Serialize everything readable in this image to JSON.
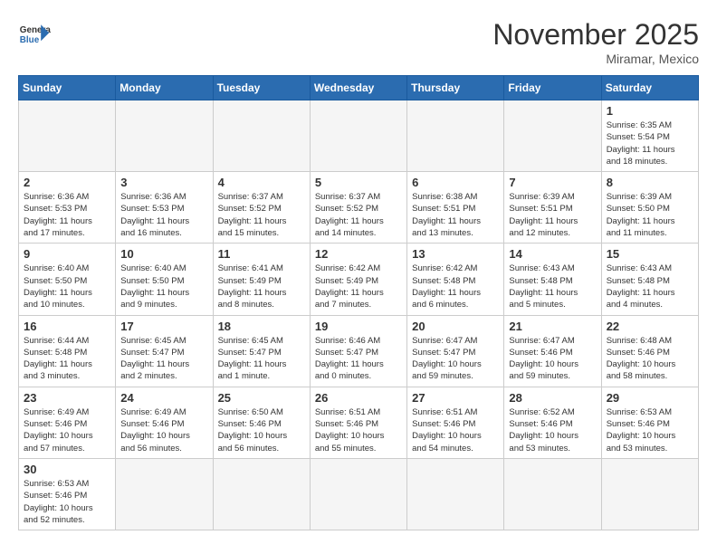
{
  "header": {
    "logo_general": "General",
    "logo_blue": "Blue",
    "month_title": "November 2025",
    "location": "Miramar, Mexico"
  },
  "weekdays": [
    "Sunday",
    "Monday",
    "Tuesday",
    "Wednesday",
    "Thursday",
    "Friday",
    "Saturday"
  ],
  "days": [
    {
      "num": "",
      "info": ""
    },
    {
      "num": "",
      "info": ""
    },
    {
      "num": "",
      "info": ""
    },
    {
      "num": "",
      "info": ""
    },
    {
      "num": "",
      "info": ""
    },
    {
      "num": "",
      "info": ""
    },
    {
      "num": "1",
      "info": "Sunrise: 6:35 AM\nSunset: 5:54 PM\nDaylight: 11 hours\nand 18 minutes."
    },
    {
      "num": "2",
      "info": "Sunrise: 6:36 AM\nSunset: 5:53 PM\nDaylight: 11 hours\nand 17 minutes."
    },
    {
      "num": "3",
      "info": "Sunrise: 6:36 AM\nSunset: 5:53 PM\nDaylight: 11 hours\nand 16 minutes."
    },
    {
      "num": "4",
      "info": "Sunrise: 6:37 AM\nSunset: 5:52 PM\nDaylight: 11 hours\nand 15 minutes."
    },
    {
      "num": "5",
      "info": "Sunrise: 6:37 AM\nSunset: 5:52 PM\nDaylight: 11 hours\nand 14 minutes."
    },
    {
      "num": "6",
      "info": "Sunrise: 6:38 AM\nSunset: 5:51 PM\nDaylight: 11 hours\nand 13 minutes."
    },
    {
      "num": "7",
      "info": "Sunrise: 6:39 AM\nSunset: 5:51 PM\nDaylight: 11 hours\nand 12 minutes."
    },
    {
      "num": "8",
      "info": "Sunrise: 6:39 AM\nSunset: 5:50 PM\nDaylight: 11 hours\nand 11 minutes."
    },
    {
      "num": "9",
      "info": "Sunrise: 6:40 AM\nSunset: 5:50 PM\nDaylight: 11 hours\nand 10 minutes."
    },
    {
      "num": "10",
      "info": "Sunrise: 6:40 AM\nSunset: 5:50 PM\nDaylight: 11 hours\nand 9 minutes."
    },
    {
      "num": "11",
      "info": "Sunrise: 6:41 AM\nSunset: 5:49 PM\nDaylight: 11 hours\nand 8 minutes."
    },
    {
      "num": "12",
      "info": "Sunrise: 6:42 AM\nSunset: 5:49 PM\nDaylight: 11 hours\nand 7 minutes."
    },
    {
      "num": "13",
      "info": "Sunrise: 6:42 AM\nSunset: 5:48 PM\nDaylight: 11 hours\nand 6 minutes."
    },
    {
      "num": "14",
      "info": "Sunrise: 6:43 AM\nSunset: 5:48 PM\nDaylight: 11 hours\nand 5 minutes."
    },
    {
      "num": "15",
      "info": "Sunrise: 6:43 AM\nSunset: 5:48 PM\nDaylight: 11 hours\nand 4 minutes."
    },
    {
      "num": "16",
      "info": "Sunrise: 6:44 AM\nSunset: 5:48 PM\nDaylight: 11 hours\nand 3 minutes."
    },
    {
      "num": "17",
      "info": "Sunrise: 6:45 AM\nSunset: 5:47 PM\nDaylight: 11 hours\nand 2 minutes."
    },
    {
      "num": "18",
      "info": "Sunrise: 6:45 AM\nSunset: 5:47 PM\nDaylight: 11 hours\nand 1 minute."
    },
    {
      "num": "19",
      "info": "Sunrise: 6:46 AM\nSunset: 5:47 PM\nDaylight: 11 hours\nand 0 minutes."
    },
    {
      "num": "20",
      "info": "Sunrise: 6:47 AM\nSunset: 5:47 PM\nDaylight: 10 hours\nand 59 minutes."
    },
    {
      "num": "21",
      "info": "Sunrise: 6:47 AM\nSunset: 5:46 PM\nDaylight: 10 hours\nand 59 minutes."
    },
    {
      "num": "22",
      "info": "Sunrise: 6:48 AM\nSunset: 5:46 PM\nDaylight: 10 hours\nand 58 minutes."
    },
    {
      "num": "23",
      "info": "Sunrise: 6:49 AM\nSunset: 5:46 PM\nDaylight: 10 hours\nand 57 minutes."
    },
    {
      "num": "24",
      "info": "Sunrise: 6:49 AM\nSunset: 5:46 PM\nDaylight: 10 hours\nand 56 minutes."
    },
    {
      "num": "25",
      "info": "Sunrise: 6:50 AM\nSunset: 5:46 PM\nDaylight: 10 hours\nand 56 minutes."
    },
    {
      "num": "26",
      "info": "Sunrise: 6:51 AM\nSunset: 5:46 PM\nDaylight: 10 hours\nand 55 minutes."
    },
    {
      "num": "27",
      "info": "Sunrise: 6:51 AM\nSunset: 5:46 PM\nDaylight: 10 hours\nand 54 minutes."
    },
    {
      "num": "28",
      "info": "Sunrise: 6:52 AM\nSunset: 5:46 PM\nDaylight: 10 hours\nand 53 minutes."
    },
    {
      "num": "29",
      "info": "Sunrise: 6:53 AM\nSunset: 5:46 PM\nDaylight: 10 hours\nand 53 minutes."
    },
    {
      "num": "30",
      "info": "Sunrise: 6:53 AM\nSunset: 5:46 PM\nDaylight: 10 hours\nand 52 minutes."
    },
    {
      "num": "",
      "info": ""
    },
    {
      "num": "",
      "info": ""
    },
    {
      "num": "",
      "info": ""
    },
    {
      "num": "",
      "info": ""
    },
    {
      "num": "",
      "info": ""
    },
    {
      "num": "",
      "info": ""
    }
  ]
}
